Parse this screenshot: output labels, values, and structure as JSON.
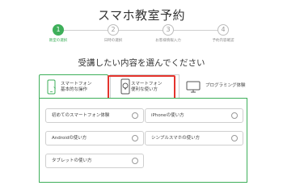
{
  "header": {
    "title": "スマホ教室予約"
  },
  "steps": [
    {
      "number": "1",
      "label": "教室の選択",
      "active": true
    },
    {
      "number": "2",
      "label": "日時の選択",
      "active": false
    },
    {
      "number": "3",
      "label": "お客様情報入力",
      "active": false
    },
    {
      "number": "4",
      "label": "予約内容確認",
      "active": false
    }
  ],
  "main": {
    "heading": "受講したい内容を選んでください",
    "tabs": [
      {
        "line1": "スマートフォン",
        "line2": "基本的な操作",
        "icon": "smartphone-icon"
      },
      {
        "line1": "スマートフォン",
        "line2": "便利な使い方",
        "icon": "smartphone-lightbulb-icon"
      },
      {
        "line1": "プログラミング体験",
        "line2": "",
        "icon": "monitor-icon"
      }
    ],
    "options": [
      {
        "label": "初めてのスマートフォン体験"
      },
      {
        "label": "iPhoneの使い方"
      },
      {
        "label": "Androidの使い方"
      },
      {
        "label": "シンプルスマホの使い方"
      },
      {
        "label": "タブレットの使い方"
      }
    ]
  },
  "colors": {
    "accent": "#3eaf5a",
    "highlight": "#e4342d",
    "border": "#cfcfcf"
  }
}
